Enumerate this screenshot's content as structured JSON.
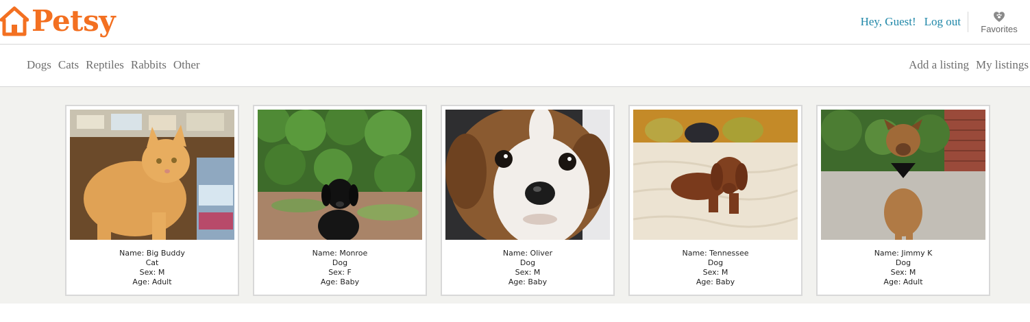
{
  "brand": {
    "name": "Petsy",
    "color": "#f37021"
  },
  "user": {
    "greeting": "Hey, Guest!",
    "logout_label": "Log out",
    "favorites_label": "Favorites"
  },
  "nav": {
    "categories": [
      "Dogs",
      "Cats",
      "Reptiles",
      "Rabbits",
      "Other"
    ],
    "actions": [
      "Add a listing",
      "My listings"
    ]
  },
  "listings": [
    {
      "name": "Name: Big Buddy",
      "type": "Cat",
      "sex": "Sex: M",
      "age": "Age: Adult",
      "photo": "orange-cat-photo"
    },
    {
      "name": "Name: Monroe",
      "type": "Dog",
      "sex": "Sex: F",
      "age": "Age: Baby",
      "photo": "black-dog-photo"
    },
    {
      "name": "Name: Oliver",
      "type": "Dog",
      "sex": "Sex: M",
      "age": "Age: Baby",
      "photo": "puppy-face-photo"
    },
    {
      "name": "Name: Tennessee",
      "type": "Dog",
      "sex": "Sex: M",
      "age": "Age: Baby",
      "photo": "brown-dog-bed-photo"
    },
    {
      "name": "Name: Jimmy K",
      "type": "Dog",
      "sex": "Sex: M",
      "age": "Age: Adult",
      "photo": "tan-dog-bandana-photo"
    }
  ],
  "colors": {
    "link": "#1f87a8",
    "nav_text": "#6e6e6e",
    "content_bg": "#f2f2ef"
  }
}
